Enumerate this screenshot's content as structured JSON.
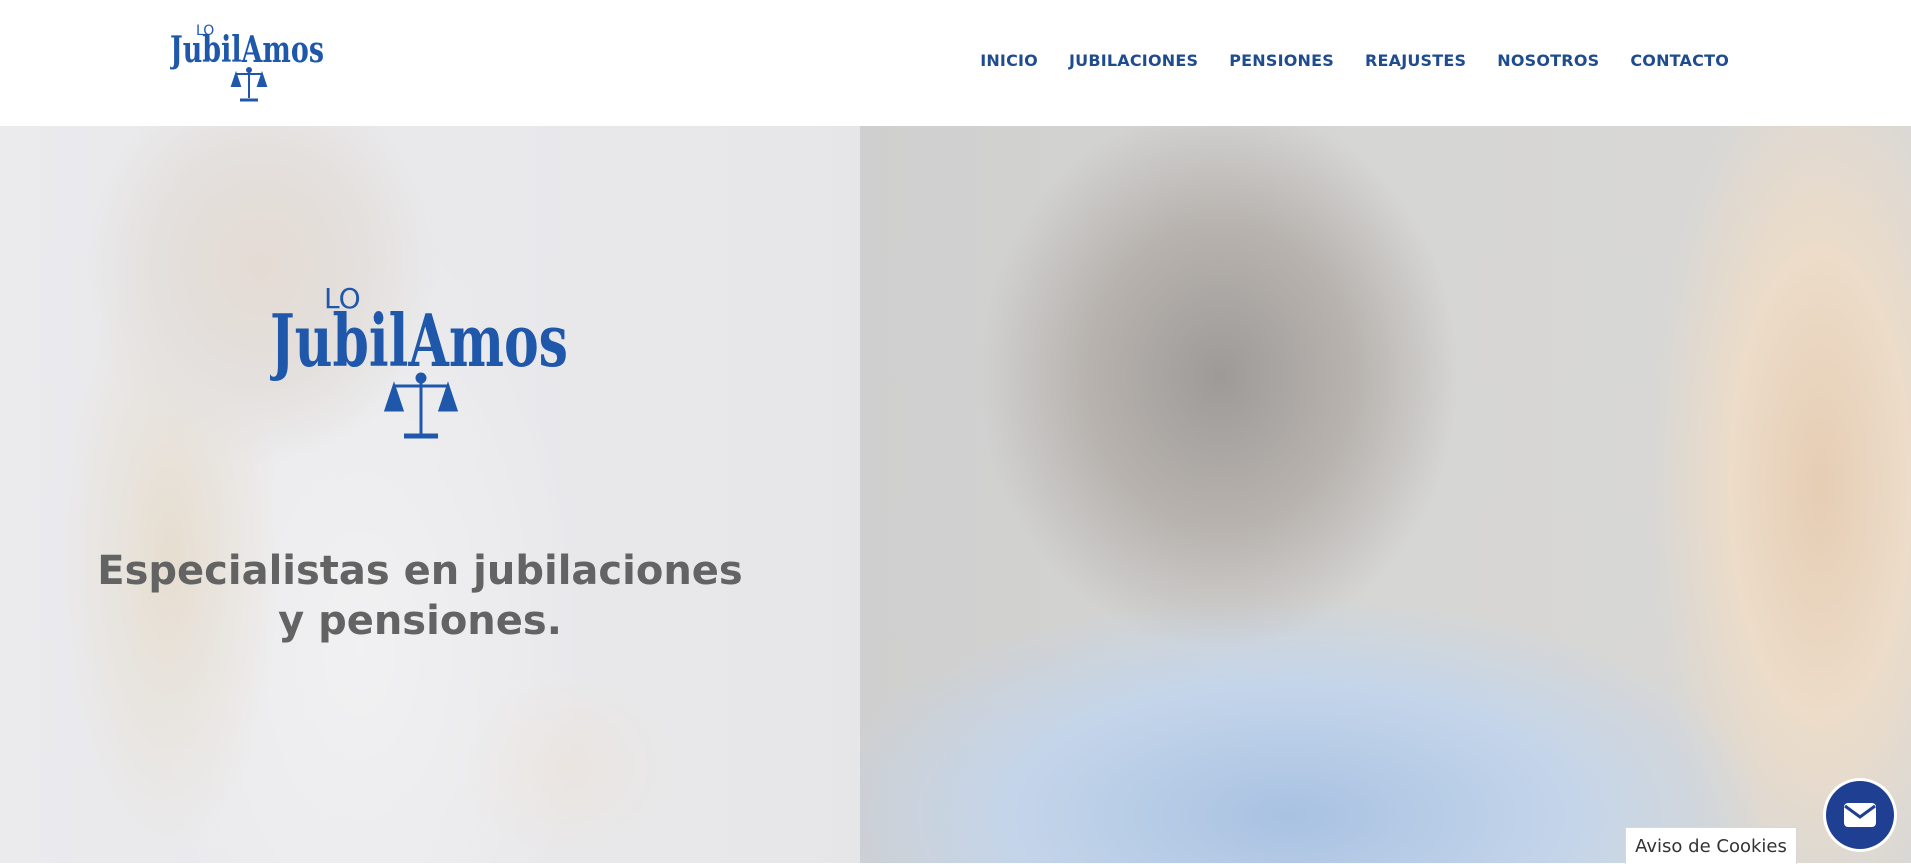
{
  "brand": {
    "prefix": "LO",
    "name": "JubilAmos",
    "colors": {
      "brand_blue": "#1f58ab",
      "nav_blue": "#1f4c8f",
      "heading_gray": "#636363",
      "mail_blue": "#1f3f93"
    },
    "icons": [
      "scales-icon"
    ]
  },
  "nav": {
    "items": [
      {
        "label": "INICIO"
      },
      {
        "label": "JUBILACIONES"
      },
      {
        "label": "PENSIONES"
      },
      {
        "label": "REAJUSTES"
      },
      {
        "label": "NOSOTROS"
      },
      {
        "label": "CONTACTO"
      }
    ]
  },
  "hero": {
    "title": "Especialistas en jubilaciones y pensiones."
  },
  "widgets": {
    "mail_icon": "envelope-icon",
    "cookie_label": "Aviso de Cookies"
  }
}
